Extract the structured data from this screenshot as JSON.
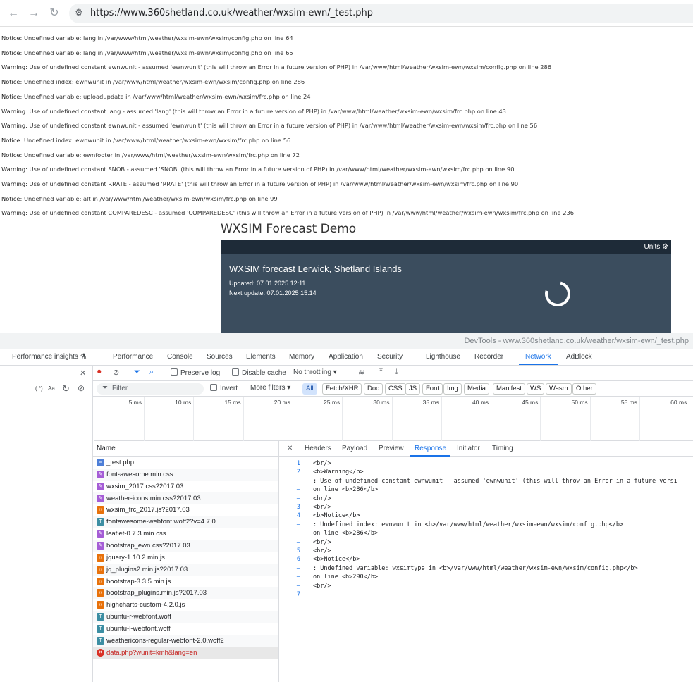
{
  "browser": {
    "url": "https://www.360shetland.co.uk/weather/wxsim-ewn/_test.php",
    "back_icon": "←",
    "forward_icon": "→",
    "reload_icon": "↻",
    "site_icon": "⚙"
  },
  "notices": [
    {
      "kind": "Notice",
      "text": ": Undefined variable: lang in ",
      "path": "/var/www/html/weather/wxsim-ewn/wxsim/config.php",
      "tail": " on line ",
      "line": "64"
    },
    {
      "kind": "Notice",
      "text": ": Undefined variable: lang in ",
      "path": "/var/www/html/weather/wxsim-ewn/wxsim/config.php",
      "tail": " on line ",
      "line": "65"
    },
    {
      "kind": "Warning",
      "text": ": Use of undefined constant ewnwunit - assumed 'ewnwunit' (this will throw an Error in a future version of PHP) in ",
      "path": "/var/www/html/weather/wxsim-ewn/wxsim/config.php",
      "tail": " on line ",
      "line": "286"
    },
    {
      "kind": "Notice",
      "text": ": Undefined index: ewnwunit in ",
      "path": "/var/www/html/weather/wxsim-ewn/wxsim/config.php",
      "tail": " on line ",
      "line": "286"
    },
    {
      "kind": "Notice",
      "text": ": Undefined variable: uploadupdate in ",
      "path": "/var/www/html/weather/wxsim-ewn/wxsim/frc.php",
      "tail": " on line ",
      "line": "24"
    },
    {
      "kind": "Warning",
      "text": ": Use of undefined constant lang - assumed 'lang' (this will throw an Error in a future version of PHP) in ",
      "path": "/var/www/html/weather/wxsim-ewn/wxsim/frc.php",
      "tail": " on line ",
      "line": "43"
    },
    {
      "kind": "Warning",
      "text": ": Use of undefined constant ewnwunit - assumed 'ewnwunit' (this will throw an Error in a future version of PHP) in ",
      "path": "/var/www/html/weather/wxsim-ewn/wxsim/frc.php",
      "tail": " on line ",
      "line": "56"
    },
    {
      "kind": "Notice",
      "text": ": Undefined index: ewnwunit in ",
      "path": "/var/www/html/weather/wxsim-ewn/wxsim/frc.php",
      "tail": " on line ",
      "line": "56"
    },
    {
      "kind": "Notice",
      "text": ": Undefined variable: ewnfooter in ",
      "path": "/var/www/html/weather/wxsim-ewn/wxsim/frc.php",
      "tail": " on line ",
      "line": "72"
    },
    {
      "kind": "Warning",
      "text": ": Use of undefined constant SNOB - assumed 'SNOB' (this will throw an Error in a future version of PHP) in ",
      "path": "/var/www/html/weather/wxsim-ewn/wxsim/frc.php",
      "tail": " on line ",
      "line": "90"
    },
    {
      "kind": "Warning",
      "text": ": Use of undefined constant RRATE - assumed 'RRATE' (this will throw an Error in a future version of PHP) in ",
      "path": "/var/www/html/weather/wxsim-ewn/wxsim/frc.php",
      "tail": " on line ",
      "line": "90"
    },
    {
      "kind": "Notice",
      "text": ": Undefined variable: alt in ",
      "path": "/var/www/html/weather/wxsim-ewn/wxsim/frc.php",
      "tail": " on line ",
      "line": "99"
    },
    {
      "kind": "Warning",
      "text": ": Use of undefined constant COMPAREDESC - assumed 'COMPAREDESC' (this will throw an Error in a future version of PHP) in ",
      "path": "/var/www/html/weather/wxsim-ewn/wxsim/frc.php",
      "tail": " on line ",
      "line": "236"
    }
  ],
  "page": {
    "title": "WXSIM Forecast Demo",
    "units_label": "Units ⚙",
    "heading": "WXSIM forecast Lerwick, Shetland Islands",
    "updated": "Updated: 07.01.2025 12:11",
    "next_update": "Next update: 07.01.2025 15:14"
  },
  "devtools": {
    "title": "DevTools - www.360shetland.co.uk/weather/wxsim-ewn/_test.php",
    "tabs": [
      "Performance insights ⚗",
      "Performance",
      "Console",
      "Sources",
      "Elements",
      "Memory",
      "Application",
      "Security",
      "Lighthouse",
      "Recorder",
      "Network",
      "AdBlock"
    ],
    "active_tab": "Network",
    "toolbar": {
      "preserve_log": "Preserve log",
      "disable_cache": "Disable cache",
      "throttling": "No throttling ▾",
      "regex": "(.*)",
      "match_case": "Aa"
    },
    "filter": {
      "placeholder": "Filter",
      "invert": "Invert",
      "more_filters": "More filters ▾",
      "chips": [
        "All",
        "Fetch/XHR",
        "Doc",
        "CSS",
        "JS",
        "Font",
        "Img",
        "Media",
        "Manifest",
        "WS",
        "Wasm",
        "Other"
      ],
      "active_chip": "All"
    },
    "timeline_ticks": [
      "5 ms",
      "10 ms",
      "15 ms",
      "20 ms",
      "25 ms",
      "30 ms",
      "35 ms",
      "40 ms",
      "45 ms",
      "50 ms",
      "55 ms",
      "60 ms"
    ],
    "requests_header": "Name",
    "requests": [
      {
        "name": "_test.php",
        "type": "doc"
      },
      {
        "name": "font-awesome.min.css",
        "type": "css"
      },
      {
        "name": "wxsim_2017.css?2017.03",
        "type": "css"
      },
      {
        "name": "weather-icons.min.css?2017.03",
        "type": "css"
      },
      {
        "name": "wxsim_frc_2017.js?2017.03",
        "type": "js"
      },
      {
        "name": "fontawesome-webfont.woff2?v=4.7.0",
        "type": "font"
      },
      {
        "name": "leaflet-0.7.3.min.css",
        "type": "css"
      },
      {
        "name": "bootstrap_ewn.css?2017.03",
        "type": "css"
      },
      {
        "name": "jquery-1.10.2.min.js",
        "type": "js"
      },
      {
        "name": "jq_plugins2.min.js?2017.03",
        "type": "js"
      },
      {
        "name": "bootstrap-3.3.5.min.js",
        "type": "js"
      },
      {
        "name": "bootstrap_plugins.min.js?2017.03",
        "type": "js"
      },
      {
        "name": "highcharts-custom-4.2.0.js",
        "type": "js"
      },
      {
        "name": "ubuntu-r-webfont.woff",
        "type": "font"
      },
      {
        "name": "ubuntu-l-webfont.woff",
        "type": "font"
      },
      {
        "name": "weathericons-regular-webfont-2.0.woff2",
        "type": "font"
      },
      {
        "name": "data.php?wunit=kmh&lang=en",
        "type": "error"
      }
    ],
    "detail_tabs": [
      "Headers",
      "Payload",
      "Preview",
      "Response",
      "Initiator",
      "Timing"
    ],
    "active_detail_tab": "Response",
    "response_lines": [
      {
        "ln": "1",
        "text": "<br/>"
      },
      {
        "ln": "2",
        "text": "<b>Warning</b>"
      },
      {
        "ln": "–",
        "text": ":  Use of undefined constant ewnwunit – assumed 'ewnwunit' (this will throw an Error in a future versi"
      },
      {
        "ln": "–",
        "text": "on line <b>286</b>"
      },
      {
        "ln": "–",
        "text": "<br/>"
      },
      {
        "ln": "3",
        "text": "<br/>"
      },
      {
        "ln": "4",
        "text": "<b>Notice</b>"
      },
      {
        "ln": "–",
        "text": ":  Undefined index: ewnwunit in <b>/var/www/html/weather/wxsim-ewn/wxsim/config.php</b>"
      },
      {
        "ln": "–",
        "text": "on line <b>286</b>"
      },
      {
        "ln": "–",
        "text": "<br/>"
      },
      {
        "ln": "5",
        "text": "<br/>"
      },
      {
        "ln": "6",
        "text": "<b>Notice</b>"
      },
      {
        "ln": "–",
        "text": ":  Undefined variable: wxsimtype in <b>/var/www/html/weather/wxsim-ewn/wxsim/config.php</b>"
      },
      {
        "ln": "–",
        "text": "on line <b>290</b>"
      },
      {
        "ln": "–",
        "text": "<br/>"
      },
      {
        "ln": "7",
        "text": ""
      }
    ]
  },
  "colors": {
    "accent": "#1a73e8",
    "panel": "#3b4d5e",
    "panel_bar": "#1e2b38",
    "error": "#c5221f"
  }
}
